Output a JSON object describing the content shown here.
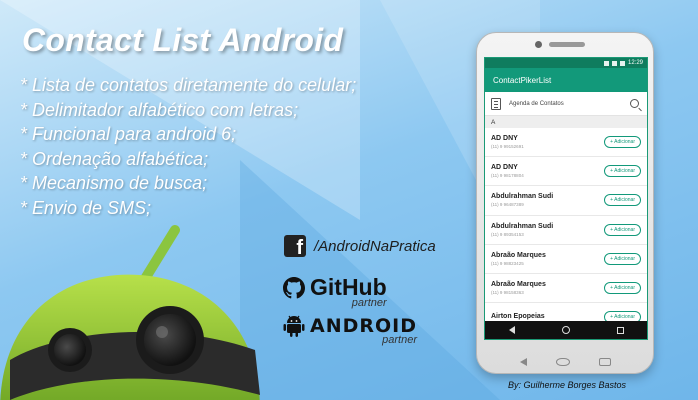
{
  "title": "Contact List Android",
  "features": [
    "*  Lista de contatos diretamente do celular;",
    "* Delimitador alfabético com letras;",
    "* Funcional para android 6;",
    "* Ordenação alfabética;",
    "* Mecanismo de busca;",
    "* Envio de SMS;"
  ],
  "social": {
    "facebook_handle": "/AndroidNaPratica",
    "github_label": "GitHub",
    "github_partner": "partner",
    "android_label": "ANDROID",
    "android_partner": "partner"
  },
  "credit": "By:  Guilherme Borges Bastos",
  "phone": {
    "status_time": "12:29",
    "app_title": "ContactPikerList",
    "search_placeholder": "Agenda de Contatos",
    "section_letter": "A",
    "add_label": "+ Adicionar",
    "contacts": [
      {
        "name": "AD DNY",
        "phone": "(11) 9 99152691"
      },
      {
        "name": "AD DNY",
        "phone": "(11) 9 98178804"
      },
      {
        "name": "Abdulrahman Sudi",
        "phone": "(11) 9 96487389"
      },
      {
        "name": "Abdulrahman Sudi",
        "phone": "(11) 9 89354153"
      },
      {
        "name": "Abraão Marques",
        "phone": "(11) 9 98823425"
      },
      {
        "name": "Abraão Marques",
        "phone": "(11) 9 98158363"
      },
      {
        "name": "Airton Epopeias",
        "phone": ""
      }
    ]
  },
  "colors": {
    "primary": "#12997a",
    "primary_dark": "#0f7c5e",
    "android_green": "#8bc53f"
  }
}
